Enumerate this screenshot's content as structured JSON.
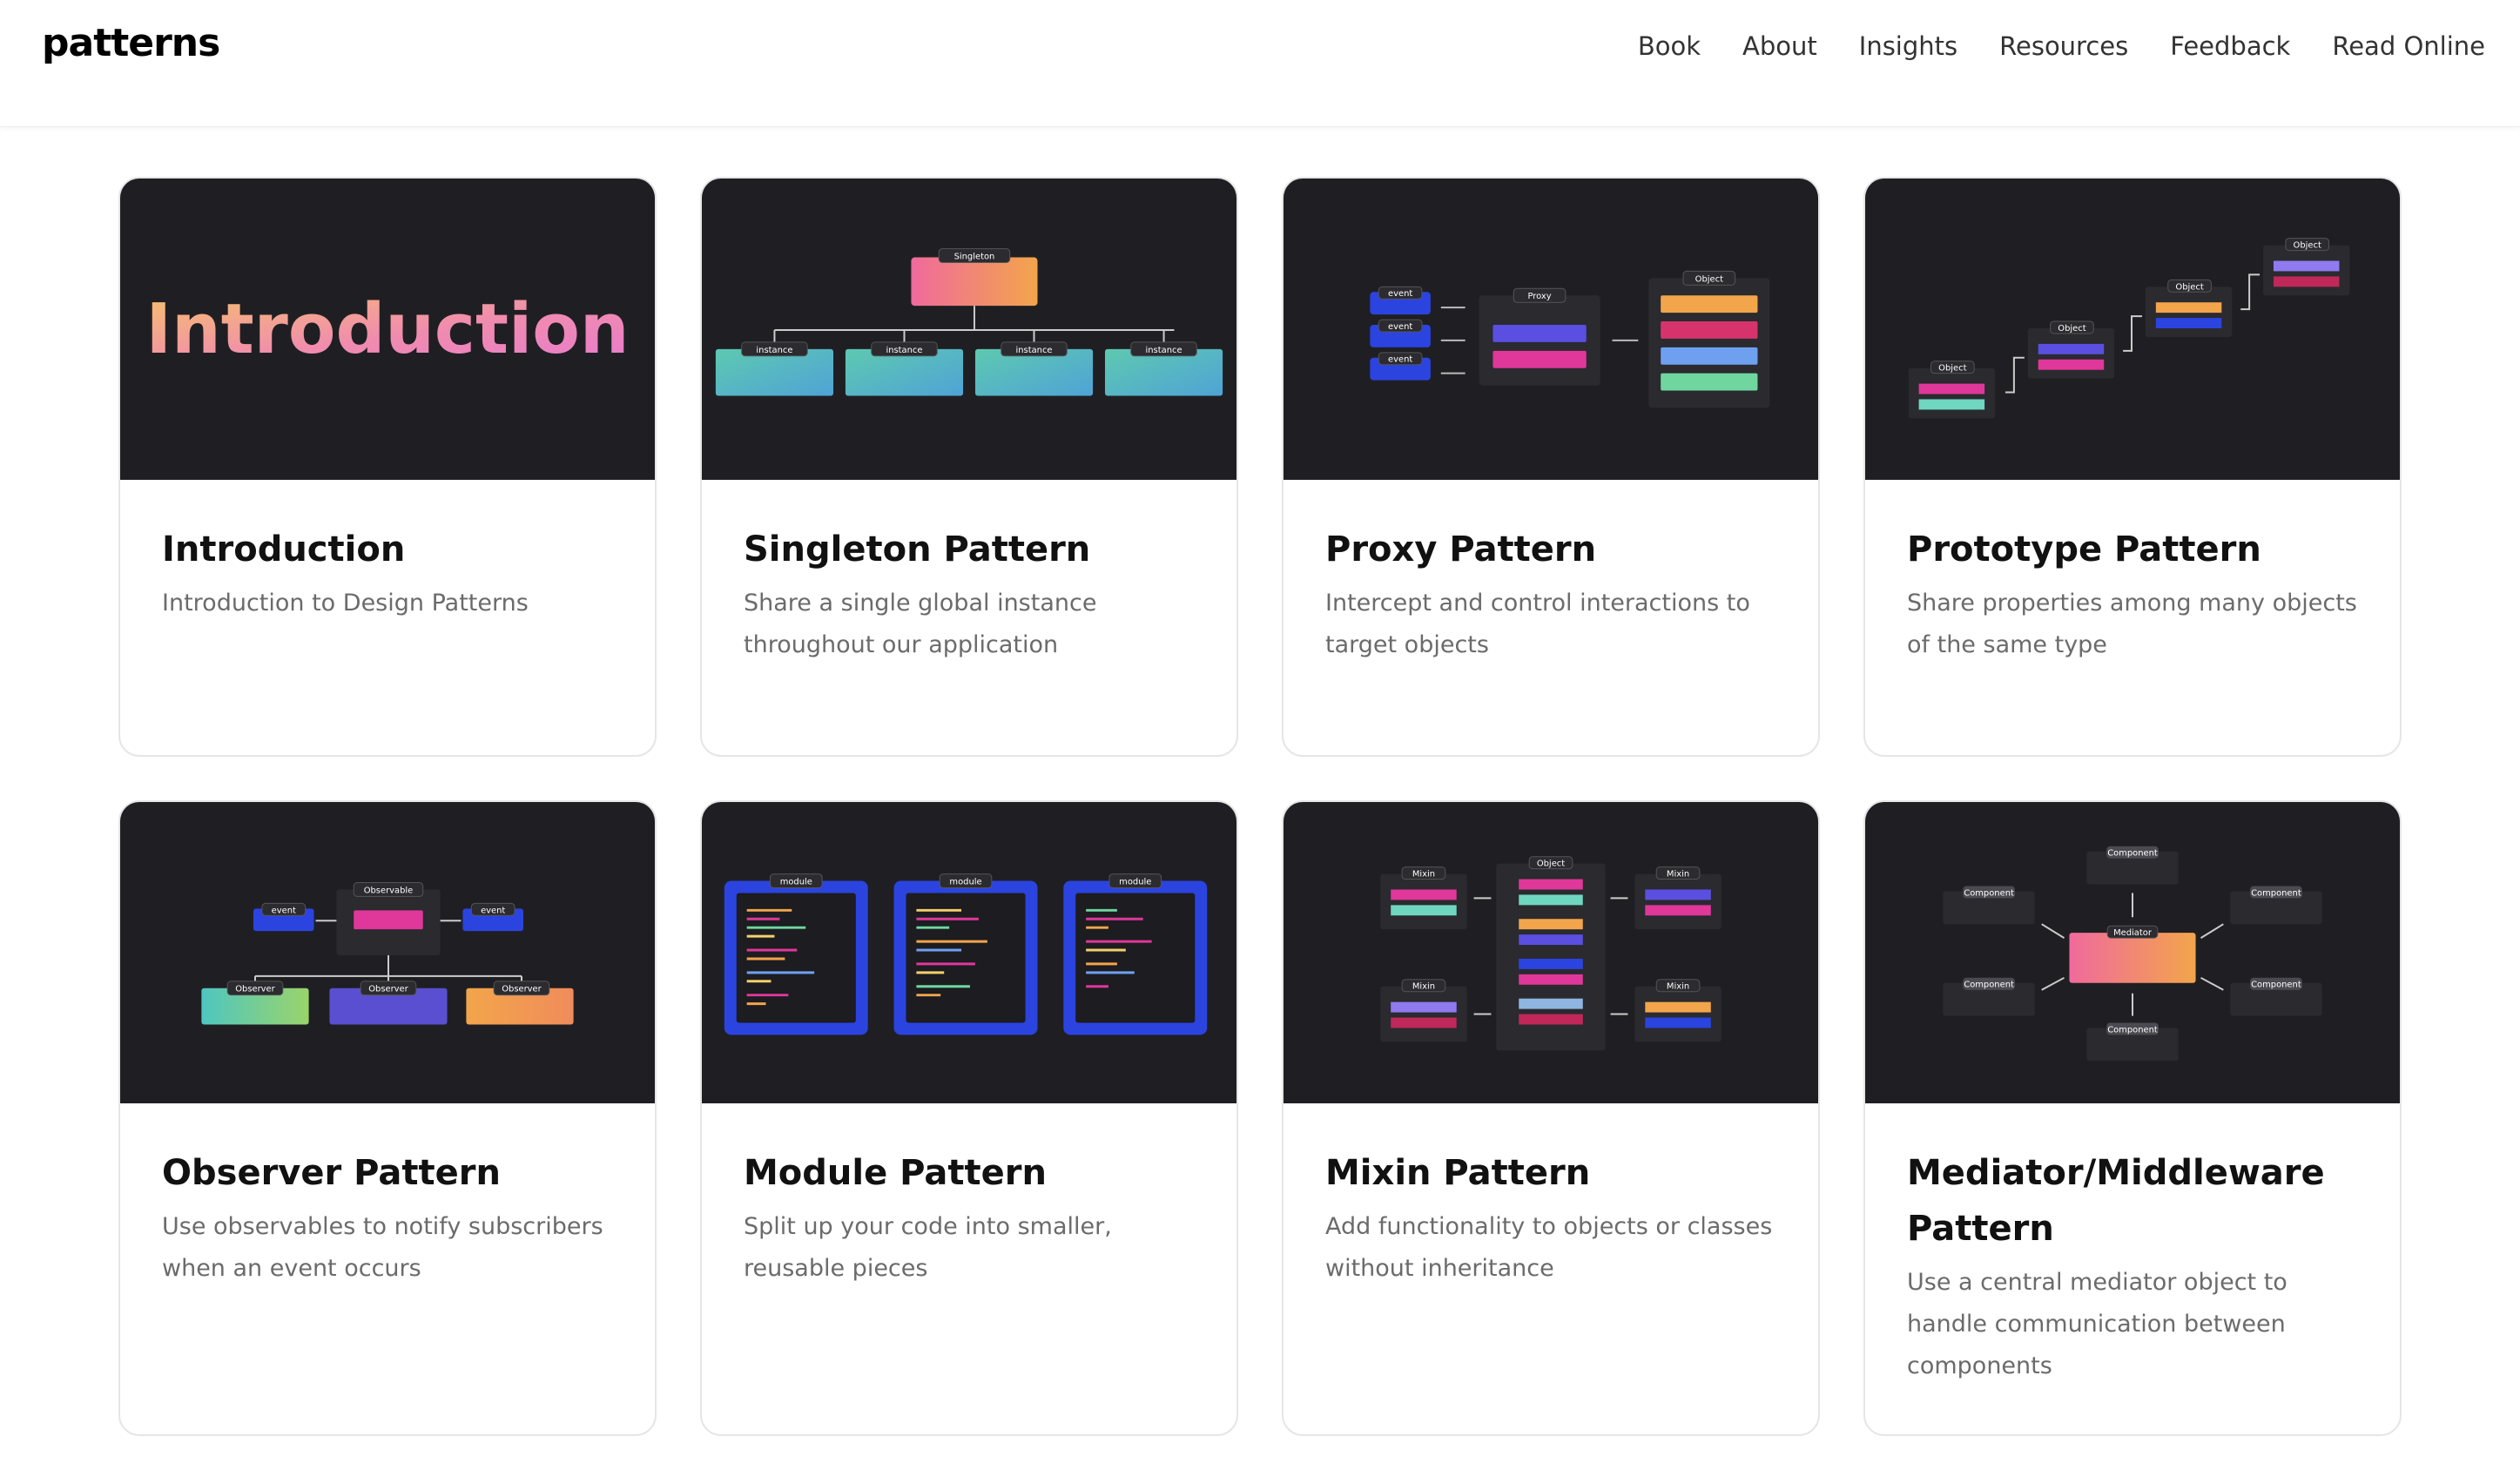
{
  "header": {
    "logo": "patterns",
    "nav": [
      "Book",
      "About",
      "Insights",
      "Resources",
      "Feedback",
      "Read Online"
    ]
  },
  "cards": [
    {
      "title": "Introduction",
      "desc": "Introduction to Design Patterns",
      "thumb_text": "Introduction"
    },
    {
      "title": "Singleton Pattern",
      "desc": "Share a single global instance throughout our application"
    },
    {
      "title": "Proxy Pattern",
      "desc": "Intercept and control interactions to target objects"
    },
    {
      "title": "Prototype Pattern",
      "desc": "Share properties among many objects of the same type"
    },
    {
      "title": "Observer Pattern",
      "desc": "Use observables to notify subscribers when an event occurs"
    },
    {
      "title": "Module Pattern",
      "desc": "Split up your code into smaller, reusable pieces"
    },
    {
      "title": "Mixin Pattern",
      "desc": "Add functionality to objects or classes without inheritance"
    },
    {
      "title": "Mediator/Middleware Pattern",
      "desc": "Use a central mediator object to handle communication between components"
    }
  ],
  "thumb_labels": {
    "singleton": "Singleton",
    "instance": "instance",
    "event": "event",
    "proxy": "Proxy",
    "object": "Object",
    "observable": "Observable",
    "observer": "Observer",
    "module": "module",
    "mixin": "Mixin",
    "mediator": "Mediator",
    "component": "Component"
  },
  "colors": {
    "thumb_bg": "#1f1f23",
    "accent_blue": "#2b44e0",
    "accent_pink": "#e0379a",
    "accent_orange": "#f2a54b",
    "accent_teal": "#5ec9b0"
  }
}
